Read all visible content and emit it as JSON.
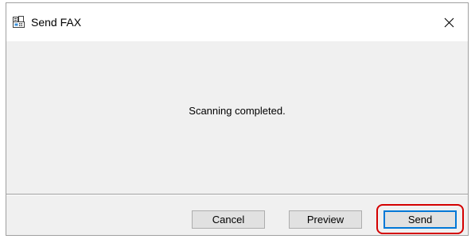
{
  "window": {
    "title": "Send FAX",
    "icon": "fax-icon",
    "close_icon": "close-icon"
  },
  "content": {
    "message": "Scanning completed."
  },
  "buttons": {
    "cancel_label": "Cancel",
    "preview_label": "Preview",
    "send_label": "Send"
  },
  "colors": {
    "dialog_bg": "#f0f0f0",
    "titlebar_bg": "#ffffff",
    "button_bg": "#e1e1e1",
    "default_button_border": "#0078d7",
    "highlight_ring": "#d40000"
  }
}
